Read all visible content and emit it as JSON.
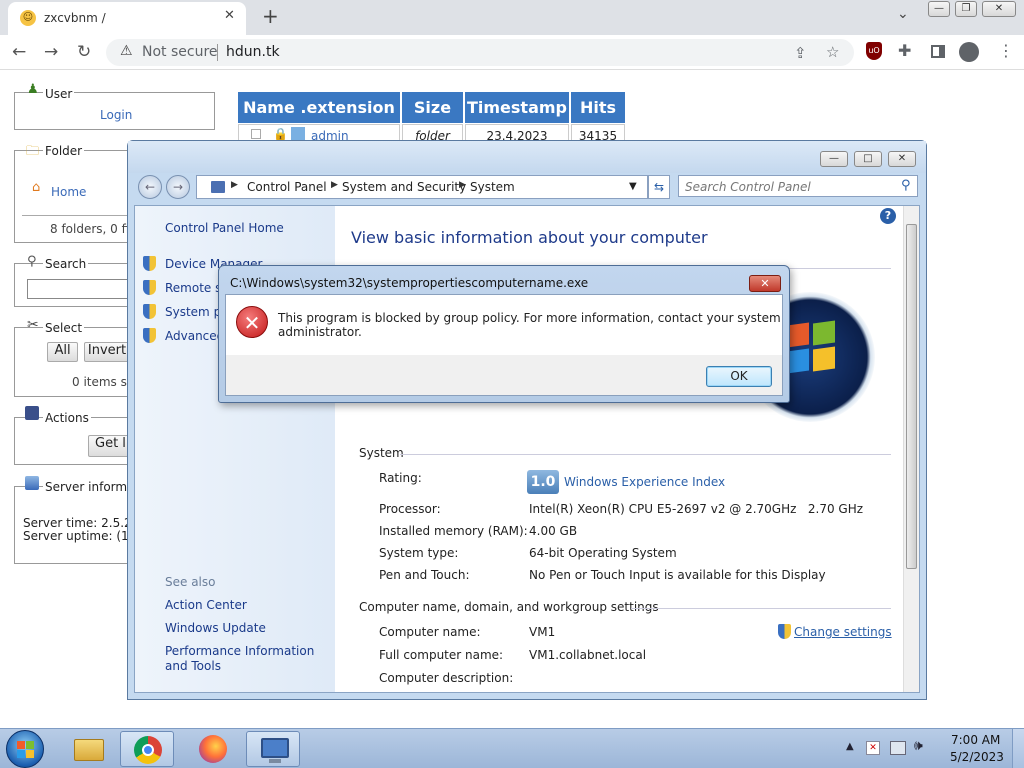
{
  "browser": {
    "tab_title": "zxcvbnm /",
    "tab_close": "✕",
    "new_tab": "+",
    "security_label": "Not secure",
    "url": "hdun.tk",
    "window_controls": [
      "—",
      "❐",
      "✕"
    ]
  },
  "page": {
    "user_legend": "User",
    "login_label": "Login",
    "folder_legend": "Folder",
    "home_label": "Home",
    "folder_count": "8 folders, 0 file",
    "search_legend": "Search",
    "select_legend": "Select",
    "all_label": "All",
    "invert_label": "Invert",
    "items_selected": "0 items se",
    "actions_legend": "Actions",
    "get_list_label": "Get lis",
    "server_legend": "Server informat",
    "server_time": "Server time: 2.5.20",
    "server_uptime": "Server uptime: (16",
    "table_headers": [
      "Name .extension",
      "Size",
      "Timestamp",
      "Hits"
    ],
    "table_row": {
      "name": "admin",
      "size": "folder",
      "timestamp": "23.4.2023 11:49:10",
      "hits": "34135"
    }
  },
  "control_panel": {
    "breadcrumb": [
      "Control Panel",
      "System and Security",
      "System"
    ],
    "search_placeholder": "Search Control Panel",
    "left_home": "Control Panel Home",
    "left_links": [
      "Device Manager",
      "Remote se",
      "System pr",
      "Advanced"
    ],
    "see_also": "See also",
    "see_also_links": [
      "Action Center",
      "Windows Update",
      "Performance Information and Tools"
    ],
    "main_title": "View basic information about your computer",
    "section_system": "System",
    "rating_label": "Rating:",
    "rating_value": "1.0",
    "rating_link": "Windows Experience Index",
    "rows": [
      {
        "label": "Processor:",
        "value": "Intel(R) Xeon(R) CPU E5-2697 v2 @ 2.70GHz   2.70 GHz"
      },
      {
        "label": "Installed memory (RAM):",
        "value": "4.00 GB"
      },
      {
        "label": "System type:",
        "value": "64-bit Operating System"
      },
      {
        "label": "Pen and Touch:",
        "value": "No Pen or Touch Input is available for this Display"
      }
    ],
    "section_computer": "Computer name, domain, and workgroup settings",
    "change_settings": "Change settings",
    "computer_rows": [
      {
        "label": "Computer name:",
        "value": "VM1"
      },
      {
        "label": "Full computer name:",
        "value": "VM1.collabnet.local"
      },
      {
        "label": "Computer description:",
        "value": ""
      }
    ]
  },
  "dialog": {
    "title": "C:\\Windows\\system32\\systempropertiescomputername.exe",
    "message_line1": "This program is blocked by group policy. For more information, contact your system",
    "message_line2": "administrator.",
    "ok_label": "OK",
    "close": "✕",
    "error_glyph": "✕"
  },
  "taskbar": {
    "time": "7:00 AM",
    "date": "5/2/2023"
  }
}
